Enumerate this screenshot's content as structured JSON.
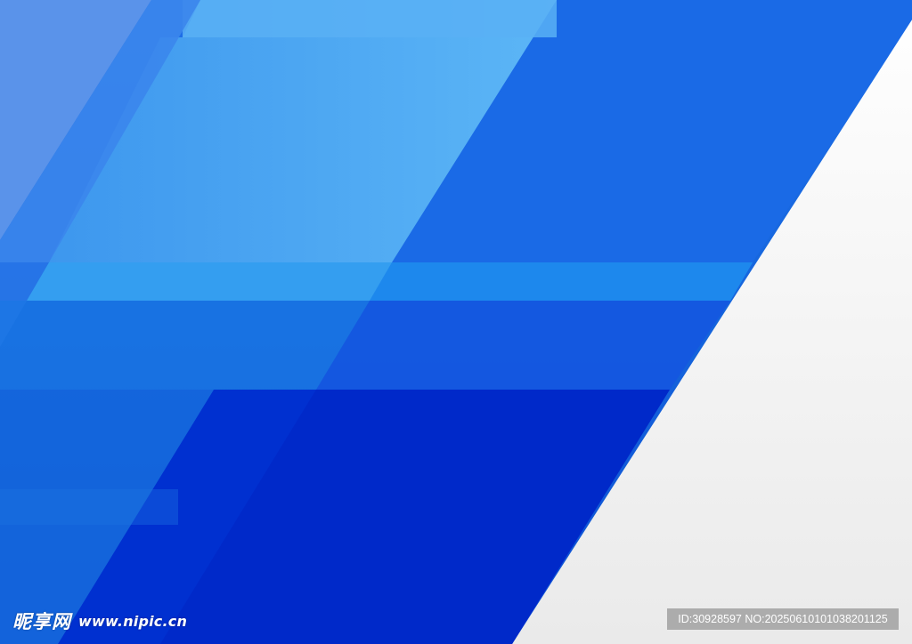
{
  "watermark": {
    "brand": "昵享网",
    "url": "www.nipic.cn",
    "id_line": "ID:30928597 NO:20250610101038201125"
  },
  "colors": {
    "white_panel_top": "#ffffff",
    "white_panel_bottom": "#ececec",
    "blue_dark": "#0030d0",
    "blue_mid": "#1a6fe6",
    "blue_light": "#4aa8f2",
    "blue_sky": "#5fb4f5"
  }
}
